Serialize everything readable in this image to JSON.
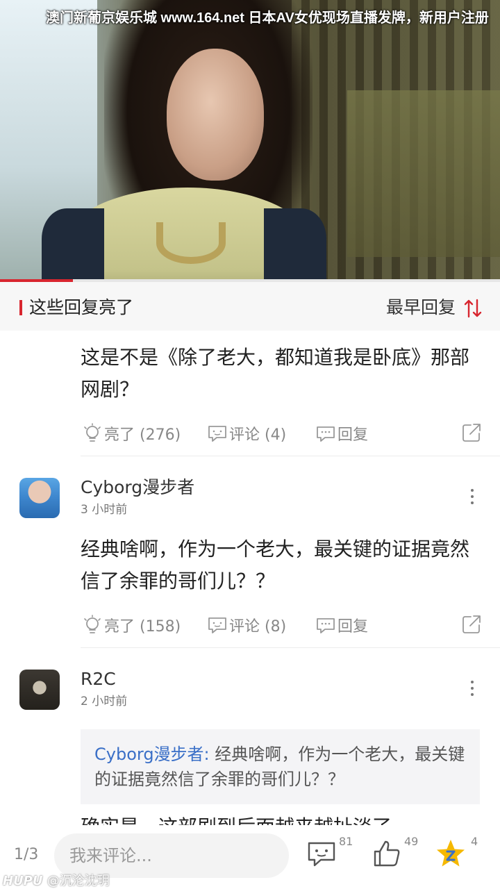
{
  "video": {
    "ticker_text": "澳门新葡京娱乐城 www.164.net 日本AV女优现场直播发牌，新用户注册",
    "progress": 0.146
  },
  "section": {
    "title": "这些回复亮了",
    "sort_label": "最早回复"
  },
  "replies": [
    {
      "text": "这是不是《除了老大，都知道我是卧底》那部网剧？",
      "likes": "亮了 (276)",
      "comments": "评论 (4)",
      "reply": "回复"
    },
    {
      "user": "Cyborg漫步者",
      "time": "3 小时前",
      "text": "经典啥啊，作为一个老大，最关键的证据竟然信了余罪的哥们儿？？",
      "likes": "亮了 (158)",
      "comments": "评论 (8)",
      "reply": "回复"
    },
    {
      "user": "R2C",
      "time": "2 小时前",
      "quote_name": "Cyborg漫步者:",
      "quote_text": " 经典啥啊，作为一个老大，最关键的证据竟然信了余罪的哥们儿？？",
      "text_partial": "确实是，这部剧到后面越来越扯淡了"
    }
  ],
  "bottom_bar": {
    "page_indicator": "1/3",
    "comment_placeholder": "我来评论...",
    "comment_count": "81",
    "like_count": "49",
    "fav_count": "4"
  },
  "watermark": {
    "brand": "HUPU",
    "user": "@沉沦沈玥"
  },
  "colors": {
    "accent": "#d8262f",
    "link": "#3a6fc7",
    "star": "#f5b800"
  }
}
